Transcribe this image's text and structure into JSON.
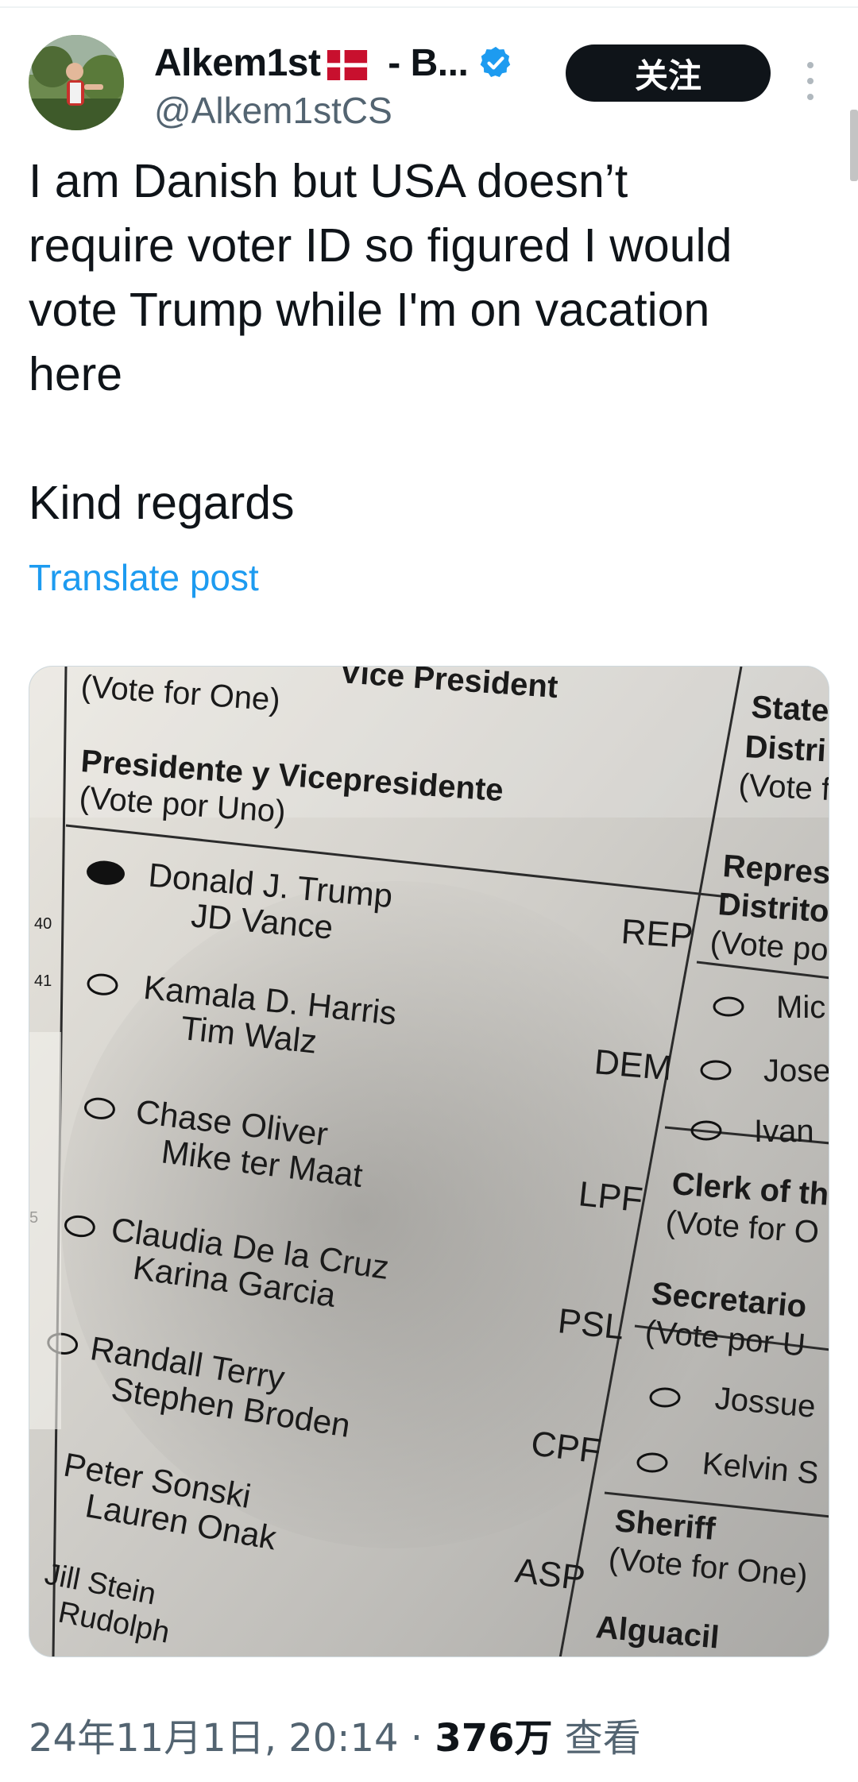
{
  "author": {
    "display_name_prefix": "Alkem1st",
    "display_name_suffix": " - B...",
    "handle": "@Alkem1stCS"
  },
  "follow_label": "关注",
  "tweet": {
    "text": "I am Danish but USA doesn’t\nrequire voter ID so figured I would\nvote Trump while I'm on vacation\nhere\n\nKind regards",
    "translate_label": "Translate post"
  },
  "ballot": {
    "header_office_fragment": "Vice President",
    "vote_for_one": "(Vote for One)",
    "office_es": "Presidente y Vicepresidente",
    "vote_por_uno": "(Vote por Uno)",
    "row_numbers": [
      "40",
      "41",
      "5"
    ],
    "candidates": [
      {
        "president": "Donald J. Trump",
        "vice": "JD Vance",
        "party": "REP",
        "filled": true
      },
      {
        "president": "Kamala D. Harris",
        "vice": "Tim Walz",
        "party": "DEM",
        "filled": false
      },
      {
        "president": "Chase Oliver",
        "vice": "Mike ter Maat",
        "party": "LPF",
        "filled": false
      },
      {
        "president": "Claudia De la Cruz",
        "vice": "Karina Garcia",
        "party": "PSL",
        "filled": false
      },
      {
        "president": "Randall Terry",
        "vice": "Stephen Broden",
        "party": "CPF",
        "filled": false
      },
      {
        "president": "Peter Sonski",
        "vice": "Lauren Onak",
        "party": "ASP",
        "filled": false
      },
      {
        "president": "Jill Stein",
        "vice": "Rudolph",
        "party": "",
        "filled": false
      }
    ],
    "right_column": {
      "state_lines": [
        "State",
        "Distri",
        "(Vote f"
      ],
      "rep_lines": [
        "Repres",
        "Distrito",
        "(Vote po"
      ],
      "rep_candidates": [
        "Mic",
        "Jose",
        "Ivan"
      ],
      "clerk_lines": [
        "Clerk of th",
        "(Vote for O"
      ],
      "secretario_lines": [
        "Secretario",
        "(Vote por U"
      ],
      "secretario_candidates": [
        "Jossue",
        "Kelvin S"
      ],
      "sheriff_lines": [
        "Sheriff",
        "(Vote for One)"
      ],
      "alguacil": "Alguacil"
    }
  },
  "meta": {
    "date": "24年11月1日, 20:14",
    "separator": " · ",
    "views_count": "376万",
    "views_label": " 查看"
  }
}
